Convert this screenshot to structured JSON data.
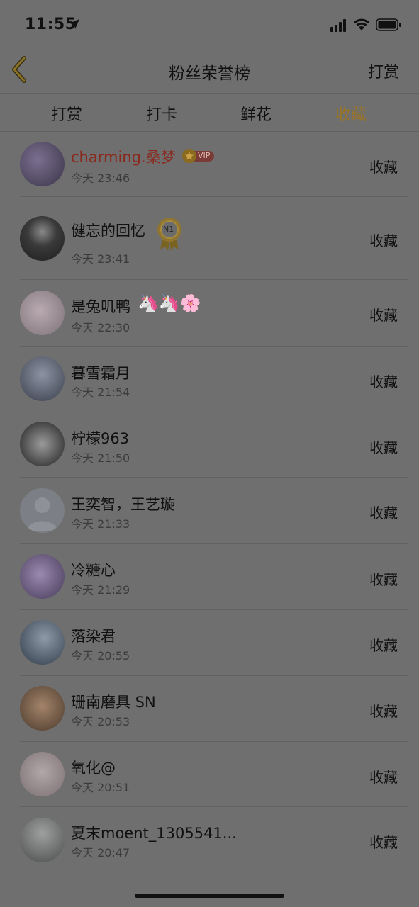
{
  "status_bar": {
    "time": "11:55"
  },
  "header": {
    "title": "粉丝荣誉榜",
    "action_label": "打赏"
  },
  "tabs": [
    {
      "label": "打赏",
      "active": false
    },
    {
      "label": "打卡",
      "active": false
    },
    {
      "label": "鲜花",
      "active": false
    },
    {
      "label": "收藏",
      "active": true
    }
  ],
  "list": [
    {
      "name": "charming.桑梦",
      "time": "今天 23:46",
      "action": "收藏",
      "vip": true,
      "avatar_color": "#4a4458"
    },
    {
      "name": "健忘的回忆",
      "time": "今天 23:41",
      "action": "收藏",
      "medal_label": "N1",
      "avatar_color": "#3a3a3a"
    },
    {
      "name": "是兔叽鸭",
      "time": "今天 22:30",
      "action": "收藏",
      "emojis": "🦄🦄🌸",
      "avatar_color": "#9b8f94"
    },
    {
      "name": "暮雪霜月",
      "time": "今天 21:54",
      "action": "收藏",
      "avatar_color": "#4f5666"
    },
    {
      "name": "柠檬963",
      "time": "今天 21:50",
      "action": "收藏",
      "avatar_color": "#3c3c3c"
    },
    {
      "name": "王奕智，王艺璇",
      "time": "今天 21:33",
      "action": "收藏",
      "avatar_color": "#7a7d84"
    },
    {
      "name": "冷糖心",
      "time": "今天 21:29",
      "action": "收藏",
      "avatar_color": "#5a4e66"
    },
    {
      "name": "落染君",
      "time": "今天 20:55",
      "action": "收藏",
      "avatar_color": "#3f4d5c"
    },
    {
      "name": "珊南磨具 SN",
      "time": "今天 20:53",
      "action": "收藏",
      "avatar_color": "#6a5342"
    },
    {
      "name": "氧化@",
      "time": "今天 20:51",
      "action": "收藏",
      "avatar_color": "#8a7f80"
    },
    {
      "name": "夏末moent_1305541...",
      "time": "今天 20:47",
      "action": "收藏",
      "avatar_color": "#6b6e6d"
    }
  ]
}
